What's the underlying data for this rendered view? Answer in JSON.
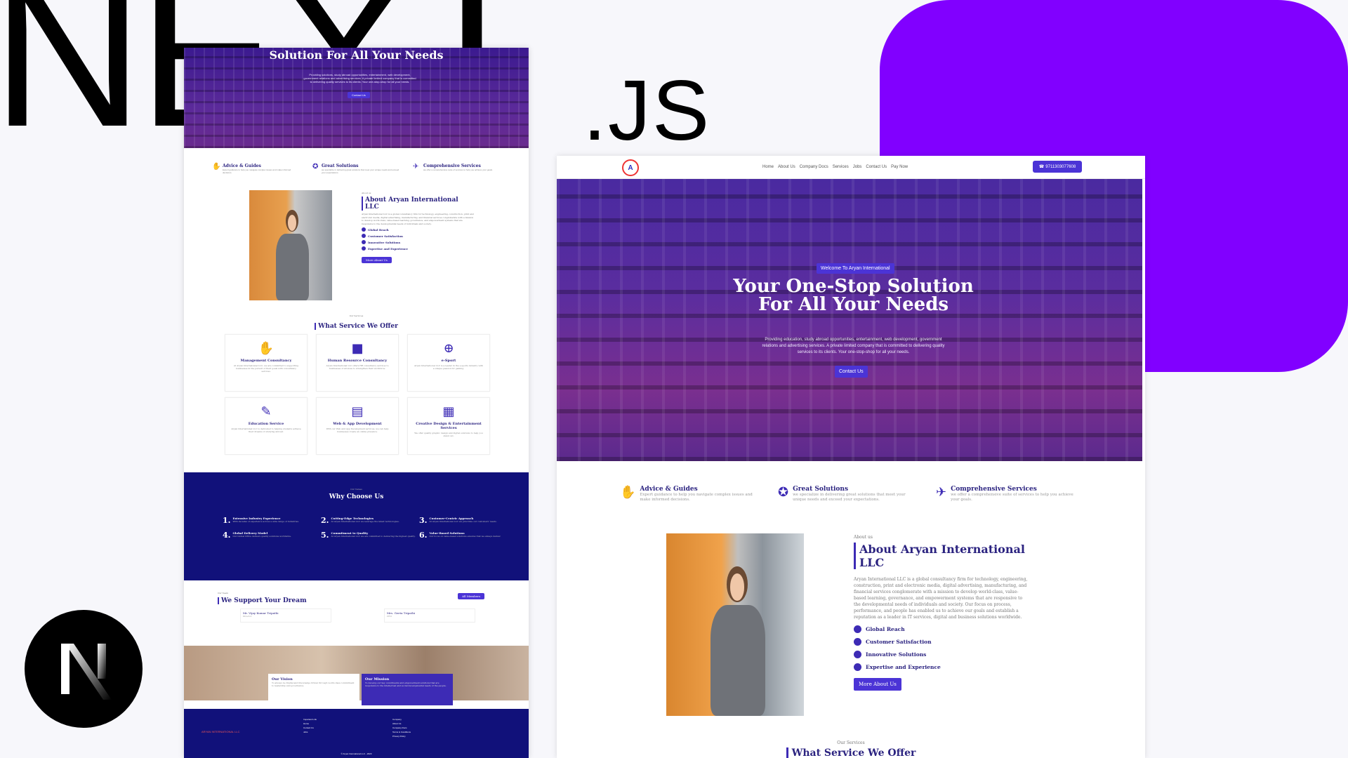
{
  "branding": {
    "big_next": "NEXT",
    "big_js": ".JS",
    "colors": {
      "brand_purple": "#8100ff",
      "primary": "#4b34d6",
      "navy": "#11117a",
      "heading": "#2b2380"
    }
  },
  "left_page": {
    "hero": {
      "title": "Solution For All Your Needs",
      "subtitle": "Providing solutions, study abroad opportunities, entertainment, web development, government relations and advertising services. A private limited company that is committed to delivering quality services to its clients. Your one-stop-shop for all your needs.",
      "cta": "Contact Us"
    },
    "features": [
      {
        "icon": "handshake-icon",
        "title": "Advice & Guides",
        "text": "Expert guidance to help you navigate complex issues and make informed decisions."
      },
      {
        "icon": "award-icon",
        "title": "Great Solutions",
        "text": "we specialize in delivering great solutions that meet your unique needs and exceed your expectations."
      },
      {
        "icon": "plane-icon",
        "title": "Comprehensive Services",
        "text": "we offer a comprehensive suite of services to help you achieve your goals."
      }
    ],
    "about": {
      "kicker": "About us",
      "title": "About Aryan International LLC",
      "text": "Aryan International LLC is a global consultancy firm for technology, engineering, construction, print and electronic media, digital advertising, manufacturing, and financial services conglomerate with a mission to develop world-class, value-based learning, governance, and empowerment systems that are responsive to the developmental needs of individuals and society.",
      "checks": [
        "Global Reach",
        "Customer Satisfaction",
        "Innovative Solutions",
        "Expertise and Experience"
      ],
      "button": "More About Us"
    },
    "services": {
      "kicker": "Our Services",
      "title": "What Service We Offer",
      "items": [
        {
          "icon": "handshake-icon",
          "title": "Management Consultancy",
          "text": "At Aryan International LLC, we are committed to supporting businesses in the pursuit of their goals with consultancy services."
        },
        {
          "icon": "briefcase-icon",
          "title": "Human Resource Consultancy",
          "text": "Aryan International LLC offers HR consultancy services to businesses of all sizes to strengthen their workforce."
        },
        {
          "icon": "gamepad-icon",
          "title": "e-Sport",
          "text": "Aryan International LLC is a leader in the e-sports industry with a unique passion for gaming."
        },
        {
          "icon": "book-icon",
          "title": "Education Service",
          "text": "Aryan International LLC is dedicated to helping students achieve their dreams of studying abroad."
        },
        {
          "icon": "window-icon",
          "title": "Web & App Development",
          "text": "With our Web and App Development services, we can help businesses create an online presence."
        },
        {
          "icon": "clapper-icon",
          "title": "Creative Design & Entertainment Services",
          "text": "We offer quality graphic design and digital solutions to help you stand out."
        }
      ]
    },
    "why": {
      "kicker": "Our Values",
      "title": "Why Choose Us",
      "items": [
        {
          "n": "1.",
          "title": "Extensive Industry Experience",
          "text": "With decades of experience across a wide range of industries."
        },
        {
          "n": "2.",
          "title": "Cutting-Edge Technologies",
          "text": "At Aryan International LLC we leverage the latest technologies."
        },
        {
          "n": "3.",
          "title": "Customer-Centric Approach",
          "text": "At Aryan International LLC we prioritize our customers' needs."
        },
        {
          "n": "4.",
          "title": "Global Delivery Model",
          "text": "Our Global Office delivers quality solutions worldwide."
        },
        {
          "n": "5.",
          "title": "Commitment to Quality",
          "text": "At Aryan International LLC we are committed to delivering the highest quality."
        },
        {
          "n": "6.",
          "title": "Value-Based Solutions",
          "text": "Our focus on value-based solutions ensures that we always deliver."
        }
      ]
    },
    "team": {
      "kicker": "Our Team",
      "title": "We Support Your Dream",
      "button": "All Members",
      "members": [
        {
          "name": "Mr. Vijay Kumar Tripathi",
          "role": "Director"
        },
        {
          "name": "Mrs. Geeta Tripathi",
          "role": "CEO"
        }
      ]
    },
    "vision": {
      "title": "Our Vision",
      "text": "To always be Digital and Knowledge Driven through world-class commitment to leadership and governance."
    },
    "mission": {
      "title": "Our Mission",
      "text": "To develop our key constituents and empowerment solutions that are responsive to the intellectual and social developmental needs of the people."
    },
    "footer": {
      "brand": "ARYAN INTERNATIONAL LLC",
      "col1": [
        "Important Link",
        "Home",
        "Contact Us",
        "Jobs"
      ],
      "col2": [
        "Company",
        "About Us",
        "Company Docs",
        "Terms & Conditions",
        "Privacy Policy"
      ],
      "copyright": "© Aryan International LLC - 2023"
    }
  },
  "right_page": {
    "nav": {
      "logo_letter": "A",
      "items": [
        "Home",
        "About Us",
        "Company Docs",
        "Services",
        "Jobs",
        "Contact Us",
        "Pay Now"
      ],
      "phone": "9711303077608"
    },
    "hero": {
      "badge": "Welcome To Aryan International",
      "title": "Your One-Stop Solution For All Your Needs",
      "subtitle": "Providing education, study abroad opportunities, entertainment, web development, government relations and advertising services. A private limited company that is committed to delivering quality services to its clients. Your one-stop-shop for all your needs.",
      "cta": "Contact Us"
    },
    "features": [
      {
        "icon": "handshake-icon",
        "title": "Advice & Guides",
        "text": "Expert guidance to help you navigate complex issues and make informed decisions."
      },
      {
        "icon": "award-icon",
        "title": "Great Solutions",
        "text": "we specialize in delivering great solutions that meet your unique needs and exceed your expectations."
      },
      {
        "icon": "plane-icon",
        "title": "Comprehensive Services",
        "text": "we offer a comprehensive suite of services to help you achieve your goals."
      }
    ],
    "about": {
      "kicker": "About us",
      "title": "About Aryan International LLC",
      "text": "Aryan International LLC is a global consultancy firm for technology, engineering, construction, print and electronic media, digital advertising, manufacturing, and financial services conglomerate with a mission to develop world-class, value-based learning, governance, and empowerment systems that are responsive to the developmental needs of individuals and society. Our focus on process, performance, and people has enabled us to achieve our goals and establish a reputation as a leader in IT services, digital and business solutions worldwide.",
      "checks": [
        "Global Reach",
        "Customer Satisfaction",
        "Innovative Solutions",
        "Expertise and Experience"
      ],
      "button": "More About Us"
    },
    "services": {
      "kicker": "Our Services",
      "title": "What Service We Offer"
    }
  }
}
